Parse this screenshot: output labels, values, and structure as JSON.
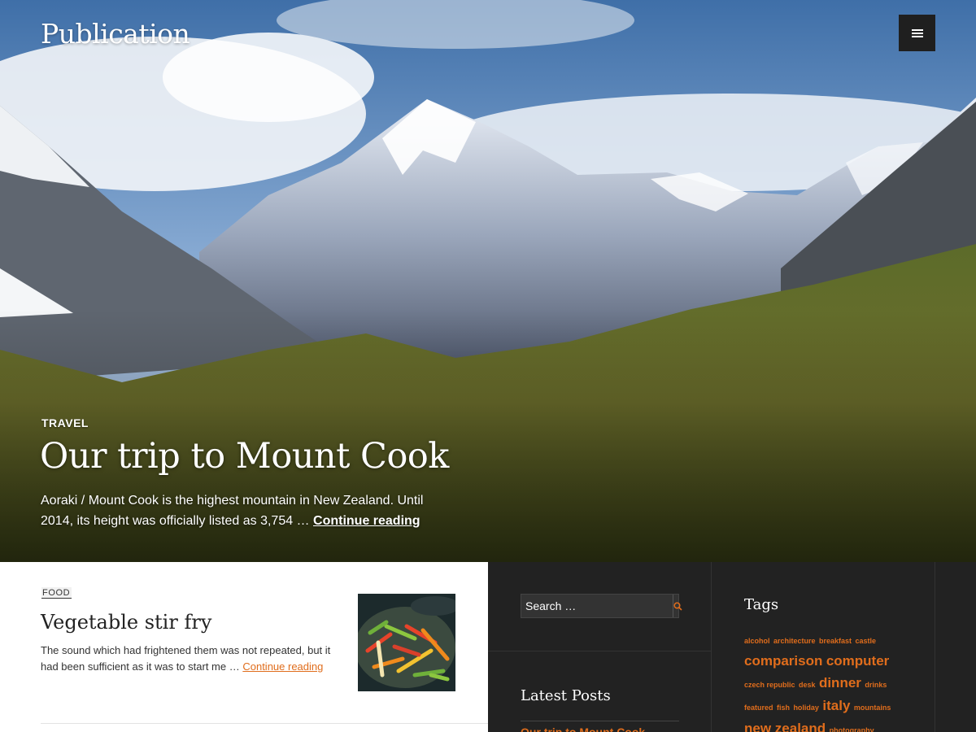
{
  "site": {
    "title": "Publication",
    "menu_icon": "hamburger-menu-icon"
  },
  "hero": {
    "category": "TRAVEL",
    "title": "Our trip to Mount Cook",
    "excerpt": "Aoraki / Mount Cook is the highest mountain in New Zealand. Until 2014, its height was officially listed as 3,754 …",
    "continue_label": "Continue reading"
  },
  "post": {
    "category": "FOOD",
    "title": "Vegetable stir fry",
    "excerpt": "The sound which had frightened them was not repeated, but it had been sufficient as it was to start me …",
    "continue_label": "Continue reading"
  },
  "search": {
    "placeholder": "Search …",
    "icon": "search-icon"
  },
  "latest_posts": {
    "title": "Latest Posts",
    "items": [
      "Our trip to Mount Cook"
    ]
  },
  "tags": {
    "title": "Tags",
    "items": [
      "alcohol",
      "architecture",
      "breakfast",
      "castle",
      "comparison",
      "computer",
      "czech republic",
      "desk",
      "dinner",
      "drinks",
      "featured",
      "fish",
      "holiday",
      "italy",
      "mountains",
      "new zealand",
      "photography"
    ]
  },
  "colors": {
    "accent": "#e06d1c",
    "sidebar_bg": "#222222",
    "content_bg": "#ffffff"
  }
}
